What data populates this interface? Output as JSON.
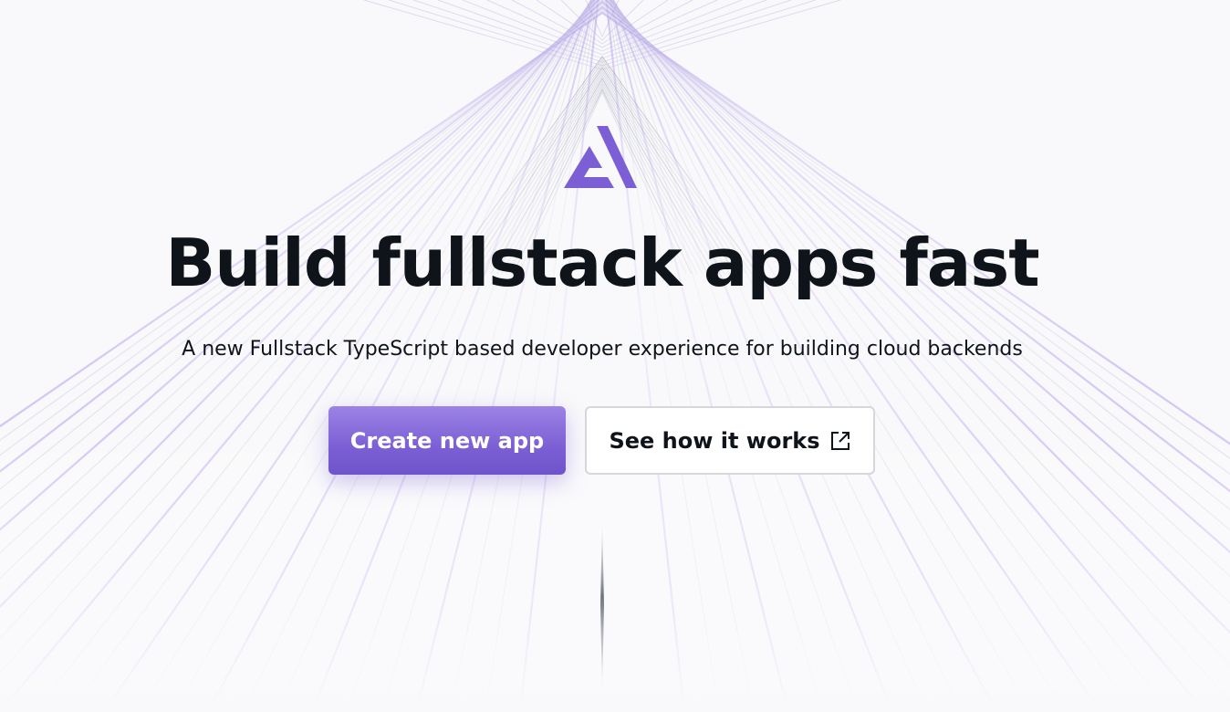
{
  "hero": {
    "title": "Build fullstack apps fast",
    "subtitle": "A new Fullstack TypeScript based developer experience for building cloud backends"
  },
  "actions": {
    "primary_label": "Create new app",
    "secondary_label": "See how it works",
    "secondary_icon": "external-link-icon"
  },
  "brand": {
    "logo_icon": "amplify-logo-icon"
  },
  "colors": {
    "accent": "#7c5fd4",
    "text": "#0f141a",
    "background": "#f9f9fb",
    "button_border": "#d5d7dc"
  }
}
